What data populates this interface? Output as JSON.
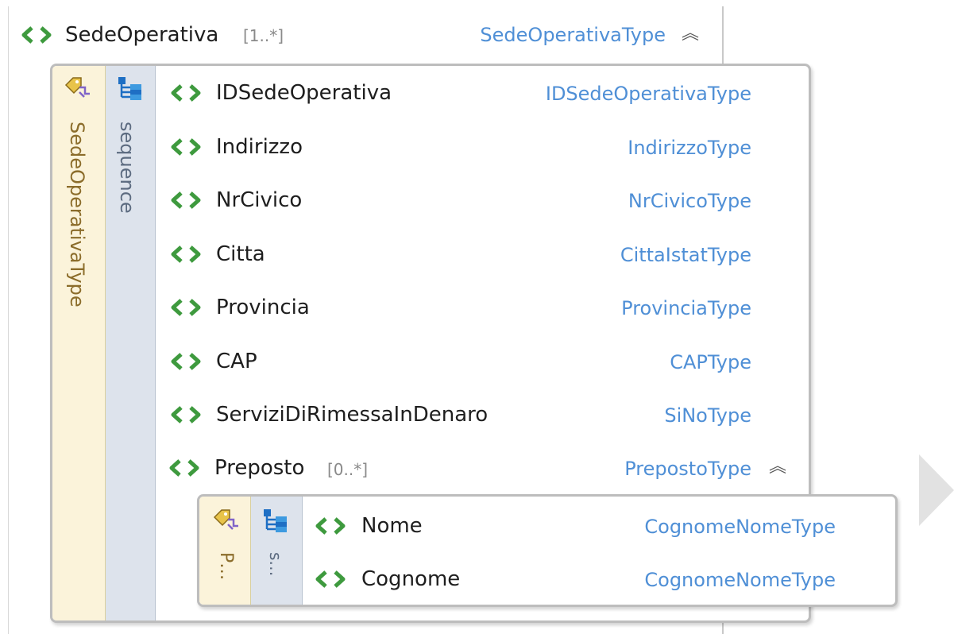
{
  "root": {
    "name": "SedeOperativa",
    "cardinality": "[1..*]",
    "type": "SedeOperativaType",
    "collapse_glyph": "︽"
  },
  "main_box": {
    "type_label": "SedeOperativaType",
    "compositor_label": "sequence",
    "children": [
      {
        "name": "IDSedeOperativa",
        "type": "IDSedeOperativaType"
      },
      {
        "name": "Indirizzo",
        "type": "IndirizzoType"
      },
      {
        "name": "NrCivico",
        "type": "NrCivicoType"
      },
      {
        "name": "Citta",
        "type": "CittaIstatType"
      },
      {
        "name": "Provincia",
        "type": "ProvinciaType"
      },
      {
        "name": "CAP",
        "type": "CAPType"
      },
      {
        "name": "ServiziDiRimessaInDenaro",
        "type": "SiNoType"
      }
    ],
    "preposto": {
      "name": "Preposto",
      "cardinality": "[0..*]",
      "type": "PrepostoType",
      "collapse_glyph": "︽"
    }
  },
  "sub_box": {
    "type_label": "P…",
    "compositor_label": "s…",
    "children": [
      {
        "name": "Nome",
        "type": "CognomeNomeType"
      },
      {
        "name": "Cognome",
        "type": "CognomeNomeType"
      }
    ]
  },
  "colors": {
    "element_icon": "#3e9a3e",
    "type_link": "#4f8fd6",
    "type_column": "#fbf3da",
    "sequence_column": "#dde3ec"
  },
  "icons": {
    "element": "element-icon",
    "complex_type": "complex-type-icon",
    "sequence": "sequence-icon",
    "collapse": "collapse-chevron-icon",
    "expand_arrow": "right-arrow-icon"
  }
}
